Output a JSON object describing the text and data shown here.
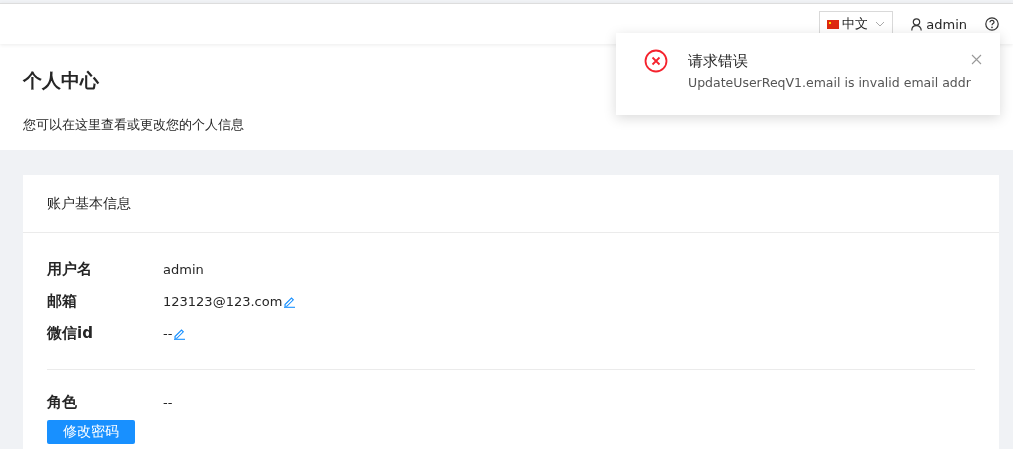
{
  "topbar": {
    "language": {
      "label": "中文"
    },
    "user": "admin"
  },
  "page_header": {
    "title": "个人中心",
    "subtitle": "您可以在这里查看或更改您的个人信息"
  },
  "card": {
    "title": "账户基本信息",
    "fields": [
      {
        "label": "用户名",
        "value": "admin",
        "editable": false
      },
      {
        "label": "邮箱",
        "value": "123123@123.com",
        "editable": true
      },
      {
        "label": "微信id",
        "value": "--",
        "editable": true
      }
    ],
    "role": {
      "label": "角色",
      "value": "--"
    },
    "button": "修改密码"
  },
  "notification": {
    "title": "请求错误",
    "message": "UpdateUserReqV1.email is invalid email addr"
  }
}
